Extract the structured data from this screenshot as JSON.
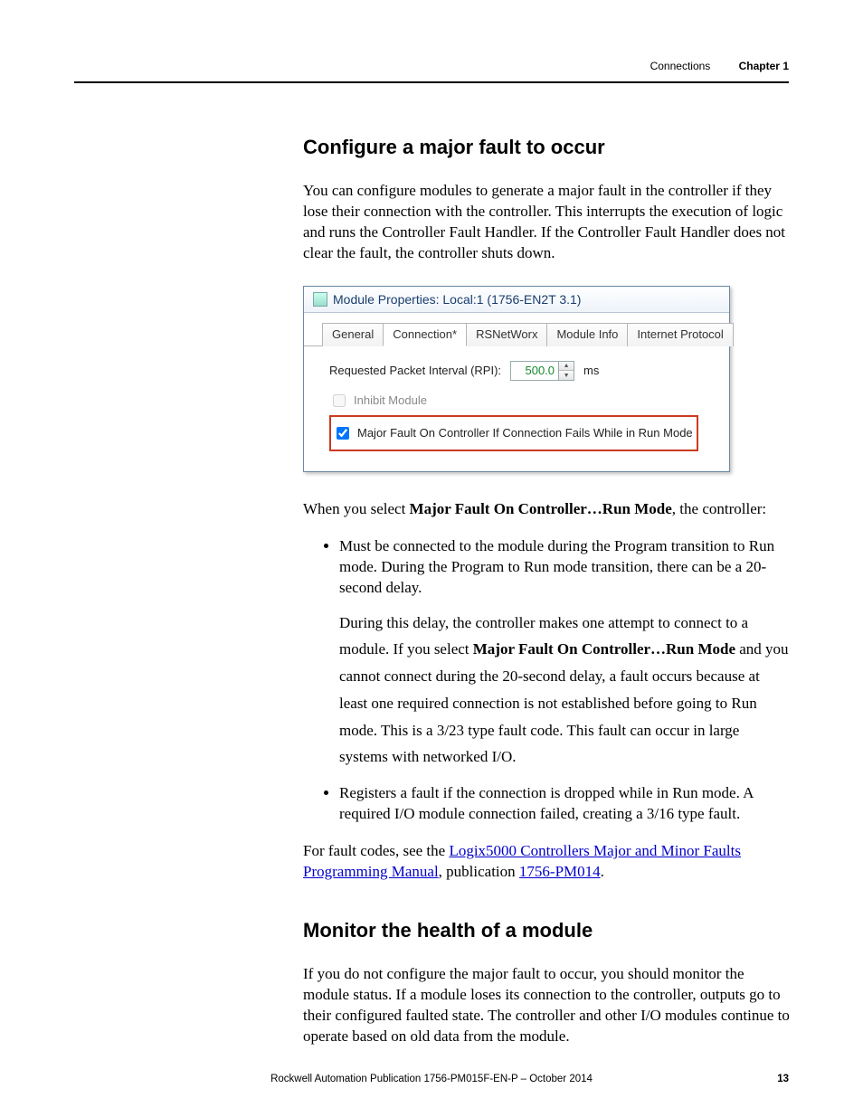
{
  "header": {
    "section": "Connections",
    "chapter": "Chapter 1"
  },
  "h1": "Configure a major fault to occur",
  "p1": "You can configure modules to generate a major fault in the controller if they lose their connection with the controller. This interrupts the execution of logic and runs the Controller Fault Handler. If the Controller Fault Handler does not clear the fault, the controller shuts down.",
  "shot": {
    "title": "Module Properties: Local:1 (1756-EN2T 3.1)",
    "tabs": [
      "General",
      "Connection*",
      "RSNetWorx",
      "Module Info",
      "Internet Protocol"
    ],
    "rpi_label": "Requested Packet Interval (RPI):",
    "rpi_value": "500.0",
    "rpi_unit": "ms",
    "inhibit": "Inhibit Module",
    "major": "Major Fault On Controller If Connection Fails While in Run Mode"
  },
  "p2a": "When you select ",
  "p2b": "Major Fault On Controller…Run Mode",
  "p2c": ", the controller:",
  "li1": "Must be connected to the module during the Program transition to Run mode. During the Program to Run mode transition, there can be a 20-second delay.",
  "li1b_a": "During this delay, the controller makes one attempt to connect to a module. If you select ",
  "li1b_b": "Major Fault On Controller…Run Mode",
  "li1b_c": " and you cannot connect during the 20-second delay, a fault occurs because at least one required connection is not established before going to Run mode. This is a 3/23 type fault code. This fault can occur in large systems with networked I/O.",
  "li2": "Registers a fault if the connection is dropped while in Run mode. A required I/O module connection failed, creating a 3/16 type fault.",
  "p3a": "For fault codes, see the ",
  "p3b": "Logix5000 Controllers Major and Minor Faults Programming Manual",
  "p3c": ", publication ",
  "p3d": "1756-PM014",
  "p3e": ".",
  "h2": "Monitor the health of a module",
  "p4": "If you do not configure the major fault to occur, you should monitor the module status. If a module loses its connection to the controller, outputs go to their configured faulted state. The controller and other I/O modules continue to operate based on old data from the module.",
  "footer": {
    "pub": "Rockwell Automation Publication 1756-PM015F-EN-P – October 2014",
    "page": "13"
  }
}
